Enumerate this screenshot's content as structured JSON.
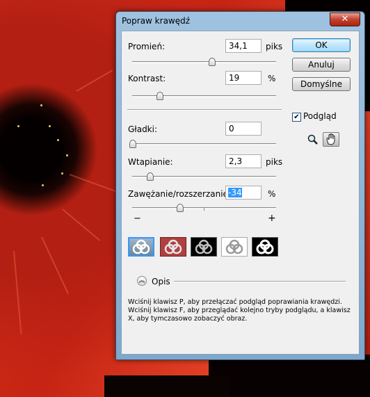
{
  "dialog": {
    "title": "Popraw krawędź",
    "close_glyph": "✕",
    "buttons": {
      "ok": "OK",
      "cancel": "Anuluj",
      "defaults": "Domyślne"
    },
    "preview": {
      "label": "Podgląd",
      "checked": true
    },
    "tools": [
      "zoom-icon",
      "hand-icon"
    ],
    "fields": {
      "radius": {
        "label": "Promień:",
        "value": "34,1",
        "unit": "piks",
        "slider_fraction": 0.55
      },
      "contrast": {
        "label": "Kontrast:",
        "value": "19",
        "unit": "%",
        "slider_fraction": 0.19
      },
      "smooth": {
        "label": "Gładki:",
        "value": "0",
        "unit": "",
        "slider_fraction": 0.0
      },
      "feather": {
        "label": "Wtapianie:",
        "value": "2,3",
        "unit": "piks",
        "slider_fraction": 0.12
      },
      "contract_expand": {
        "label": "Zawężanie/rozszerzanie:",
        "value": "-34",
        "unit": "%",
        "minus": "−",
        "plus": "+",
        "slider_fraction": 0.33
      }
    },
    "preview_modes": [
      "standard-mode",
      "quick-mask-mode",
      "on-black-mode",
      "on-white-mode",
      "mask-mode"
    ],
    "description": {
      "toggle_label": "Opis",
      "text": "Wciśnij klawisz P, aby przełączać podgląd poprawiania krawędzi. Wciśnij klawisz F, aby przeglądać kolejno tryby podglądu, a klawisz X, aby tymczasowo zobaczyć obraz."
    },
    "colors": {
      "title_bar": "#9fc2e0",
      "close": "#c4402d",
      "selection": "#3399ff"
    }
  }
}
